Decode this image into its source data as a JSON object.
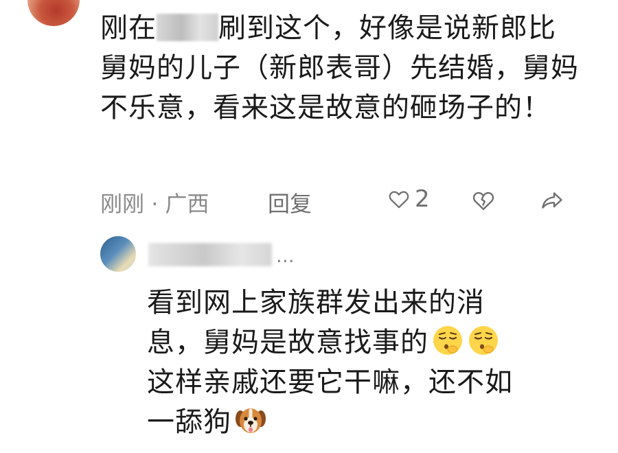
{
  "comment": {
    "text_before_blur": "刚在",
    "text_after_blur": "刷到这个，好像是说新郎比舅妈的儿子（新郎表哥）先结婚，舅妈不乐意，看来这是故意的砸场子的！",
    "time": "刚刚",
    "separator": "·",
    "location": "广西",
    "reply_label": "回复",
    "like_count": "2"
  },
  "reply": {
    "name_suffix": "...",
    "line1": "看到网上家族群发出来的消",
    "line2": "息，舅妈是故意找事的",
    "line3": "这样亲戚还要它干嘛，还不如",
    "line4": "一舔狗"
  },
  "icons": [
    "heart-icon",
    "broken-heart-icon",
    "share-icon",
    "pensive-emoji-icon",
    "dog-emoji-icon"
  ]
}
